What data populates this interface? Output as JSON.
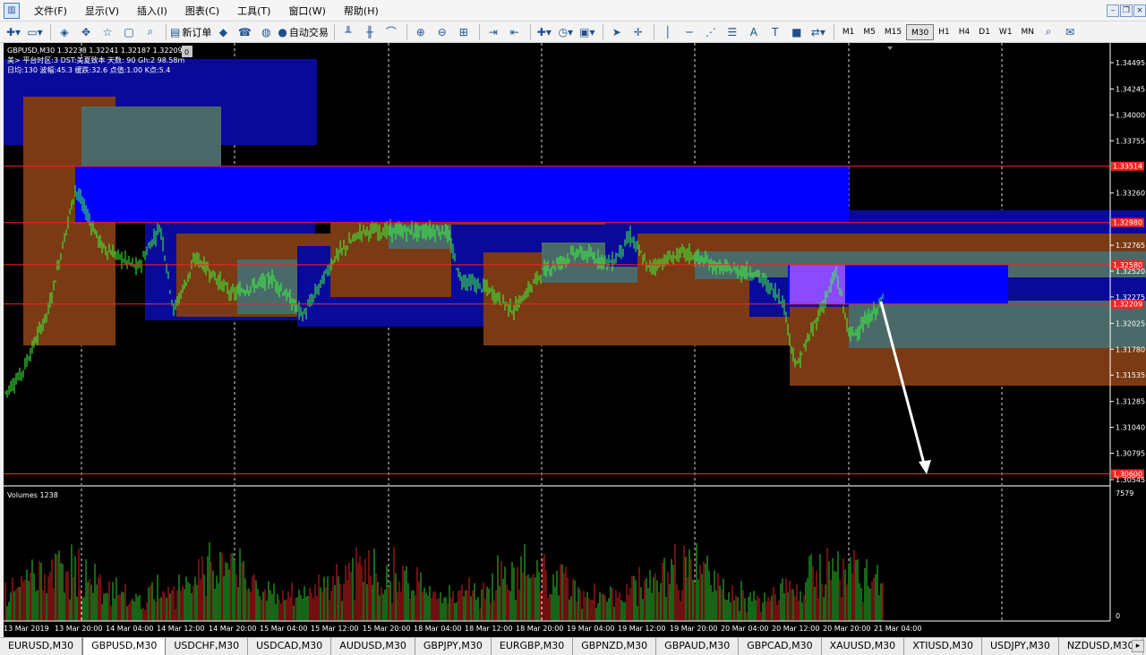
{
  "menubar": {
    "items": [
      "文件(F)",
      "显示(V)",
      "插入(I)",
      "图表(C)",
      "工具(T)",
      "窗口(W)",
      "帮助(H)"
    ],
    "app_icon": "mt4-chart-icon"
  },
  "toolbar": {
    "new_order_label": "新订单",
    "auto_trade_label": "自动交易",
    "timeframes": [
      "M1",
      "M5",
      "M15",
      "M30",
      "H1",
      "H4",
      "D1",
      "W1",
      "MN"
    ],
    "active_timeframe": "M30"
  },
  "chart": {
    "header": "GBPUSD,M30  1.32238 1.32241 1.32187 1.32209",
    "header_badge": "0",
    "info_line1": "美> 平台时区:3  DST:美夏致本 天数: 90  Gh:2  98.58m",
    "info_line2": "日均:130  波幅:45.3  缓跌:32.6  点值:1.00  K点:5.4",
    "volume_label": "Volumes 1238",
    "volume_max": "7579",
    "volume_min": "0",
    "price_ticks": [
      "1.34495",
      "1.34245",
      "1.34000",
      "1.33755",
      "1.33260",
      "1.32765",
      "1.32520",
      "1.32275",
      "1.32025",
      "1.31780",
      "1.31535",
      "1.31285",
      "1.31040",
      "1.30795",
      "1.30545"
    ],
    "price_tick_values": [
      1.34495,
      1.34245,
      1.34,
      1.33755,
      1.3326,
      1.32765,
      1.3252,
      1.32275,
      1.32025,
      1.3178,
      1.31535,
      1.31285,
      1.3104,
      1.30795,
      1.30545
    ],
    "red_levels": [
      {
        "label": "1.33514",
        "value": 1.33514
      },
      {
        "label": "1.32980",
        "value": 1.3298
      },
      {
        "label": "1.32580",
        "value": 1.3258
      },
      {
        "label": "1.32209",
        "value": 1.32209
      },
      {
        "label": "1.30600",
        "value": 1.306
      }
    ],
    "date_labels": [
      "13 Mar 2019",
      "13 Mar 20:00",
      "14 Mar 04:00",
      "14 Mar 12:00",
      "14 Mar 20:00",
      "15 Mar 04:00",
      "15 Mar 12:00",
      "15 Mar 20:00",
      "18 Mar 04:00",
      "18 Mar 12:00",
      "18 Mar 20:00",
      "19 Mar 04:00",
      "19 Mar 12:00",
      "19 Mar 20:00",
      "20 Mar 04:00",
      "20 Mar 12:00",
      "20 Mar 20:00",
      "21 Mar 04:00"
    ],
    "colors": {
      "background": "#000000",
      "candle": "#3cff3c",
      "red_line": "#ff2020",
      "blue_zone": "#0000ff",
      "brown_box": "#7a3a14",
      "gray_box": "#4a6a6a",
      "navy_box": "#0a0a9a",
      "purple_box": "#8a4aff",
      "volume_up": "#2ecc2e",
      "volume_down": "#e02020",
      "arrow": "#ffffff"
    }
  },
  "tabs": {
    "items": [
      "EURUSD,M30",
      "GBPUSD,M30",
      "USDCHF,M30",
      "USDCAD,M30",
      "AUDUSD,M30",
      "GBPJPY,M30",
      "EURGBP,M30",
      "GBPNZD,M30",
      "GBPAUD,M30",
      "GBPCAD,M30",
      "XAUUSD,M30",
      "XTIUSD,M30",
      "USDJPY,M30",
      "NZDUSD,M30"
    ],
    "active": "GBPUSD,M30"
  }
}
